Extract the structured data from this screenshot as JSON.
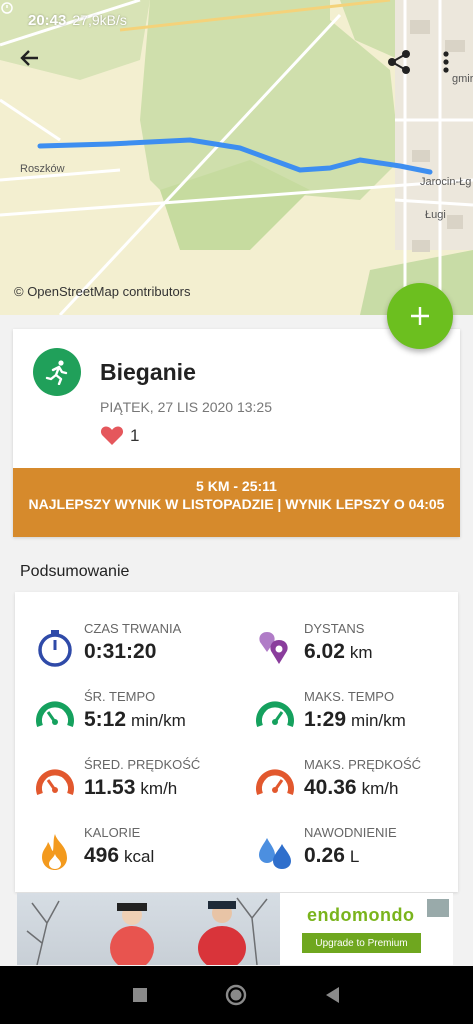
{
  "status_bar": {
    "time": "20:43",
    "speed": "27,9kB/s"
  },
  "map": {
    "places": {
      "west": "Roszków",
      "east": "Jarocin-Łg",
      "south": "Ługi",
      "northeast": "gmir"
    },
    "attribution": "© OpenStreetMap contributors"
  },
  "workout": {
    "sport": "Bieganie",
    "date": "PIĄTEK, 27 LIS 2020 13:25",
    "likes": "1"
  },
  "banner": {
    "line1": "5 KM  -  25:11",
    "line2": "NAJLEPSZY WYNIK W LISTOPADZIE  |  WYNIK LEPSZY O 04:05"
  },
  "summary": {
    "title": "Podsumowanie",
    "stats": [
      {
        "label": "CZAS TRWANIA",
        "value": "0:31:20",
        "unit": ""
      },
      {
        "label": "DYSTANS",
        "value": "6.02",
        "unit": "km"
      },
      {
        "label": "ŚR. TEMPO",
        "value": "5:12",
        "unit": "min/km"
      },
      {
        "label": "MAKS. TEMPO",
        "value": "1:29",
        "unit": "min/km"
      },
      {
        "label": "ŚRED. PRĘDKOŚĆ",
        "value": "11.53",
        "unit": "km/h"
      },
      {
        "label": "MAKS. PRĘDKOŚĆ",
        "value": "40.36",
        "unit": "km/h"
      },
      {
        "label": "KALORIE",
        "value": "496",
        "unit": "kcal"
      },
      {
        "label": "NAWODNIENIE",
        "value": "0.26",
        "unit": "L"
      }
    ]
  },
  "ad": {
    "brand": "endomondo",
    "cta": "Upgrade to Premium"
  },
  "colors": {
    "accent_green": "#6cbf1f",
    "sport_green": "#20a05a",
    "banner_orange": "#d68a2c",
    "route_blue": "#3d8ef0"
  }
}
